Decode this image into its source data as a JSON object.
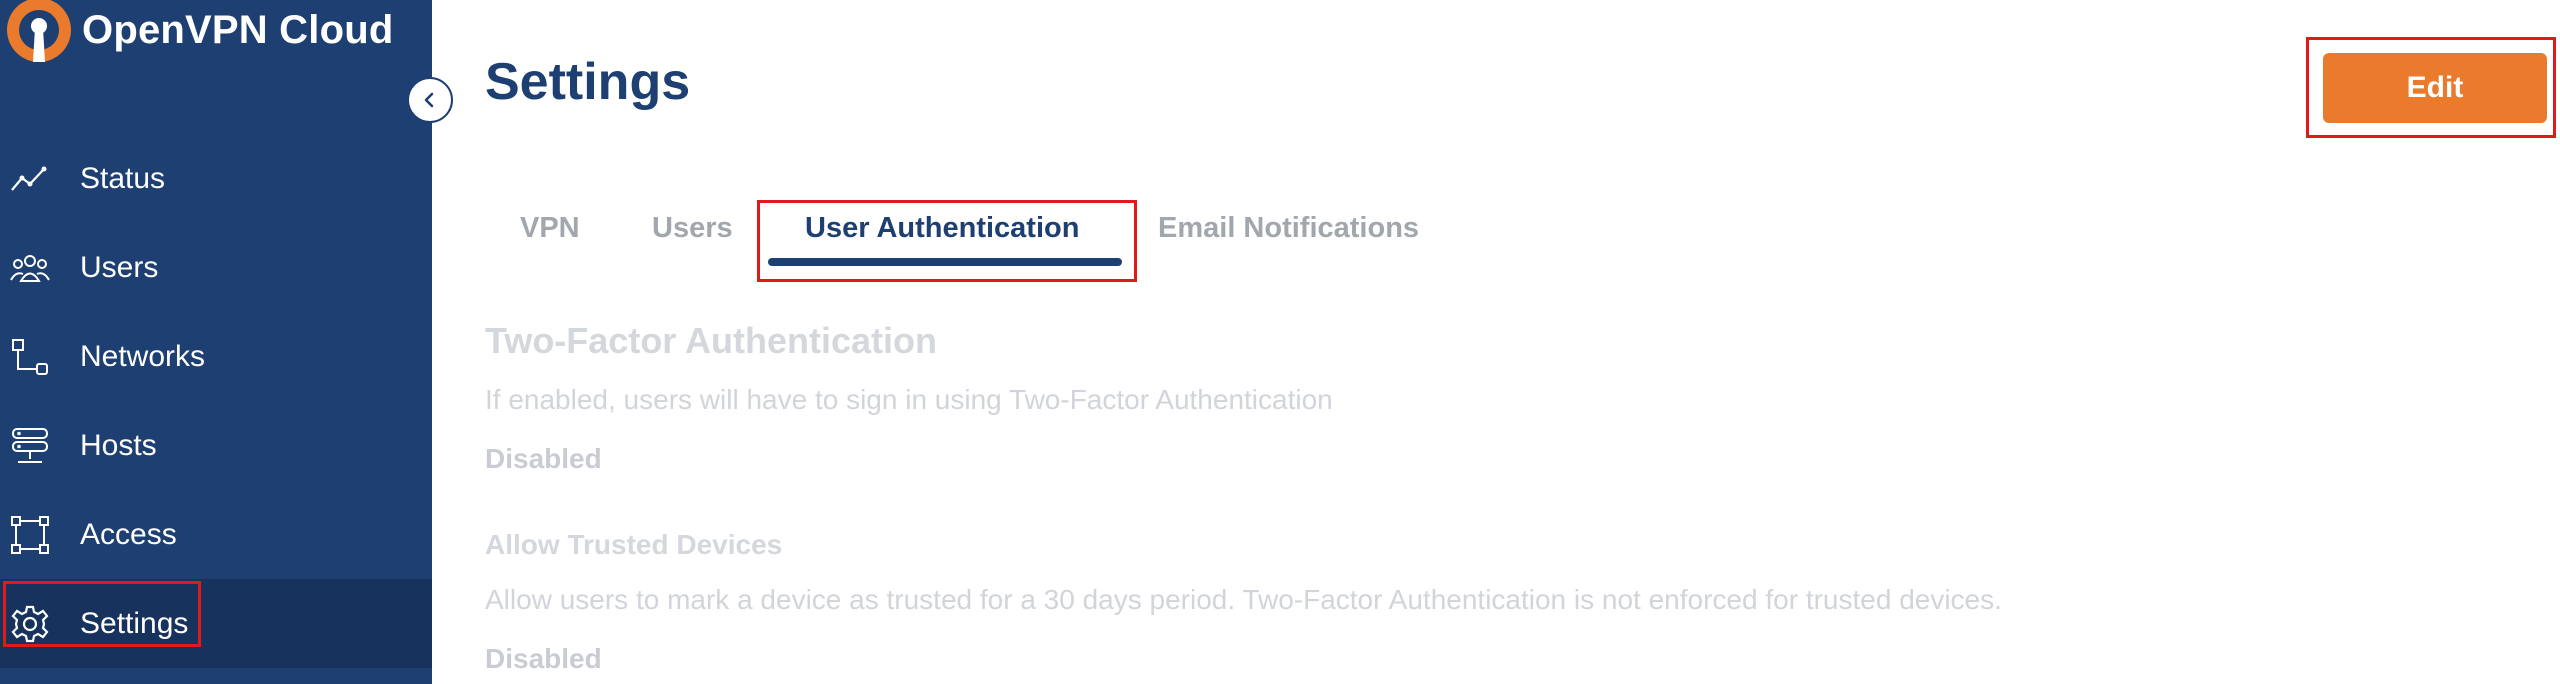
{
  "app": {
    "name": "OpenVPN Cloud",
    "logo_icon": "openvpn-keyhole-logo"
  },
  "colors": {
    "sidebar": "#1d3f71",
    "accent": "#ea7a2c",
    "highlight": "#e01a1a"
  },
  "sidebar": {
    "collapse_icon": "chevron-left-icon",
    "items": [
      {
        "label": "Status",
        "icon": "trend-line-icon"
      },
      {
        "label": "Users",
        "icon": "users-group-icon"
      },
      {
        "label": "Networks",
        "icon": "network-icon"
      },
      {
        "label": "Hosts",
        "icon": "server-stack-icon"
      },
      {
        "label": "Access",
        "icon": "access-nodes-icon"
      },
      {
        "label": "Settings",
        "icon": "gear-icon",
        "active": true
      }
    ]
  },
  "header": {
    "title": "Settings",
    "edit_label": "Edit"
  },
  "tabs": [
    {
      "label": "VPN"
    },
    {
      "label": "Users"
    },
    {
      "label": "User Authentication",
      "active": true
    },
    {
      "label": "Email Notifications"
    }
  ],
  "sections": {
    "two_factor": {
      "title": "Two-Factor Authentication",
      "description": "If enabled, users will have to sign in using Two-Factor Authentication",
      "status": "Disabled"
    },
    "trusted_devices": {
      "title": "Allow Trusted Devices",
      "description": "Allow users to mark a device as trusted for a 30 days period. Two-Factor Authentication is not enforced for trusted devices.",
      "status": "Disabled"
    }
  }
}
